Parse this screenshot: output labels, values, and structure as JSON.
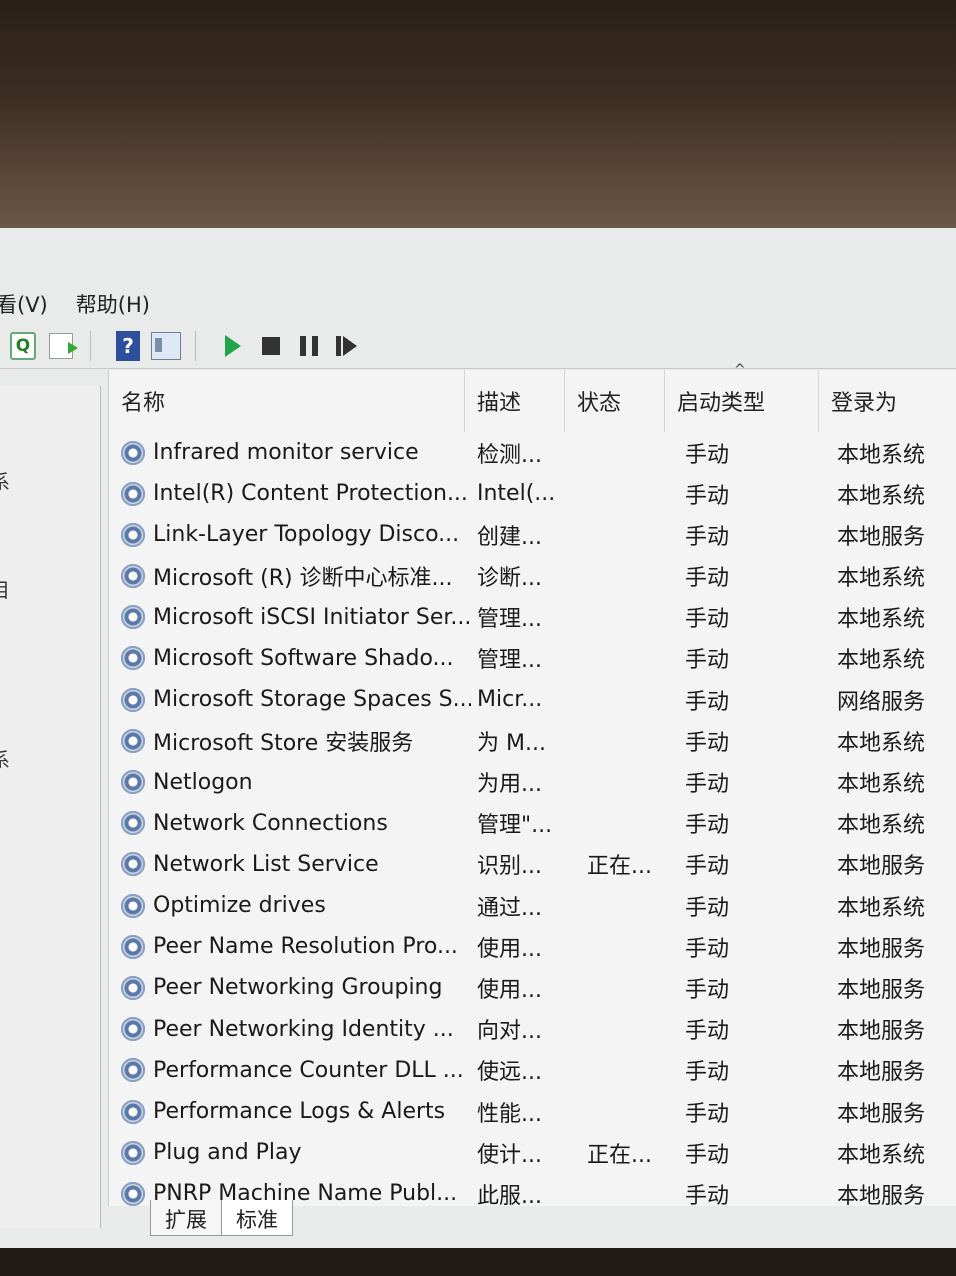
{
  "menu": {
    "view": "看(V)",
    "help": "帮助(H)"
  },
  "toolbar": {
    "help_glyph": "?"
  },
  "left_pane": {
    "items": [
      "系",
      "目",
      "系"
    ]
  },
  "columns": {
    "name": "名称",
    "description": "描述",
    "status": "状态",
    "startup_type": "启动类型",
    "logon_as": "登录为"
  },
  "services": [
    {
      "name": "Infrared monitor service",
      "description": "检测...",
      "status": "",
      "startup": "手动",
      "logon": "本地系统"
    },
    {
      "name": "Intel(R) Content Protection...",
      "description": "Intel(...",
      "status": "",
      "startup": "手动",
      "logon": "本地系统"
    },
    {
      "name": "Link-Layer Topology Disco...",
      "description": "创建...",
      "status": "",
      "startup": "手动",
      "logon": "本地服务"
    },
    {
      "name": "Microsoft (R) 诊断中心标准...",
      "description": "诊断...",
      "status": "",
      "startup": "手动",
      "logon": "本地系统"
    },
    {
      "name": "Microsoft iSCSI Initiator Ser...",
      "description": "管理...",
      "status": "",
      "startup": "手动",
      "logon": "本地系统"
    },
    {
      "name": "Microsoft Software Shado...",
      "description": "管理...",
      "status": "",
      "startup": "手动",
      "logon": "本地系统"
    },
    {
      "name": "Microsoft Storage Spaces S...",
      "description": "Micr...",
      "status": "",
      "startup": "手动",
      "logon": "网络服务"
    },
    {
      "name": "Microsoft Store 安装服务",
      "description": "为 M...",
      "status": "",
      "startup": "手动",
      "logon": "本地系统"
    },
    {
      "name": "Netlogon",
      "description": "为用...",
      "status": "",
      "startup": "手动",
      "logon": "本地系统"
    },
    {
      "name": "Network Connections",
      "description": "管理\"...",
      "status": "",
      "startup": "手动",
      "logon": "本地系统"
    },
    {
      "name": "Network List Service",
      "description": "识别...",
      "status": "正在...",
      "startup": "手动",
      "logon": "本地服务"
    },
    {
      "name": "Optimize drives",
      "description": "通过...",
      "status": "",
      "startup": "手动",
      "logon": "本地系统"
    },
    {
      "name": "Peer Name Resolution Pro...",
      "description": "使用...",
      "status": "",
      "startup": "手动",
      "logon": "本地服务"
    },
    {
      "name": "Peer Networking Grouping",
      "description": "使用...",
      "status": "",
      "startup": "手动",
      "logon": "本地服务"
    },
    {
      "name": "Peer Networking Identity ...",
      "description": "向对...",
      "status": "",
      "startup": "手动",
      "logon": "本地服务"
    },
    {
      "name": "Performance Counter DLL ...",
      "description": "使远...",
      "status": "",
      "startup": "手动",
      "logon": "本地服务"
    },
    {
      "name": "Performance Logs & Alerts",
      "description": "性能...",
      "status": "",
      "startup": "手动",
      "logon": "本地服务"
    },
    {
      "name": "Plug and Play",
      "description": "使计...",
      "status": "正在...",
      "startup": "手动",
      "logon": "本地系统"
    },
    {
      "name": "PNRP Machine Name Publ...",
      "description": "此服...",
      "status": "",
      "startup": "手动",
      "logon": "本地服务"
    }
  ],
  "tabs": [
    "扩展",
    "标准"
  ]
}
